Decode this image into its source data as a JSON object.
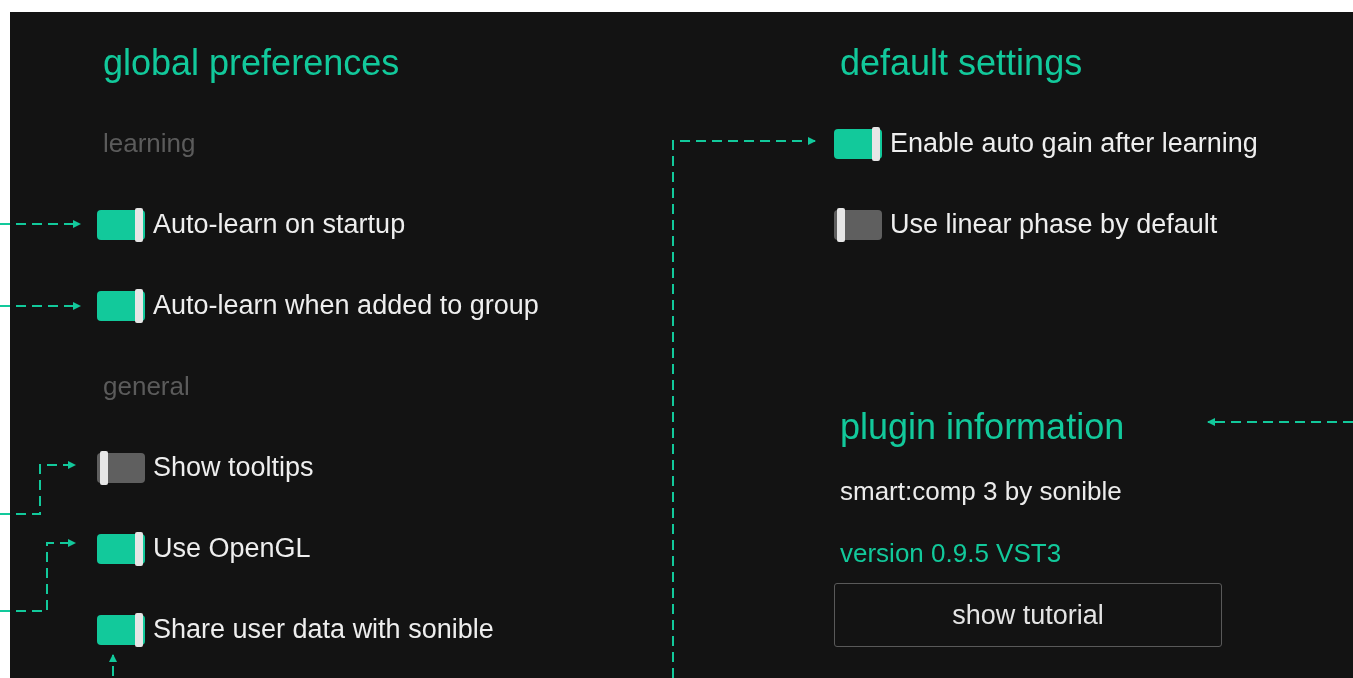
{
  "global_preferences": {
    "title": "global preferences",
    "groups": [
      {
        "label": "learning",
        "toggles": [
          {
            "label": "Auto-learn on startup",
            "on": true
          },
          {
            "label": "Auto-learn when added to group",
            "on": true
          }
        ]
      },
      {
        "label": "general",
        "toggles": [
          {
            "label": "Show tooltips",
            "on": false
          },
          {
            "label": "Use OpenGL",
            "on": true
          },
          {
            "label": "Share user data with sonible",
            "on": true
          }
        ]
      }
    ]
  },
  "default_settings": {
    "title": "default settings",
    "toggles": [
      {
        "label": "Enable auto gain after learning",
        "on": true
      },
      {
        "label": "Use linear phase by default",
        "on": false
      }
    ]
  },
  "plugin_information": {
    "title": "plugin information",
    "product": "smart:comp 3 by sonible",
    "version": "version 0.9.5 VST3",
    "button": "show tutorial"
  }
}
